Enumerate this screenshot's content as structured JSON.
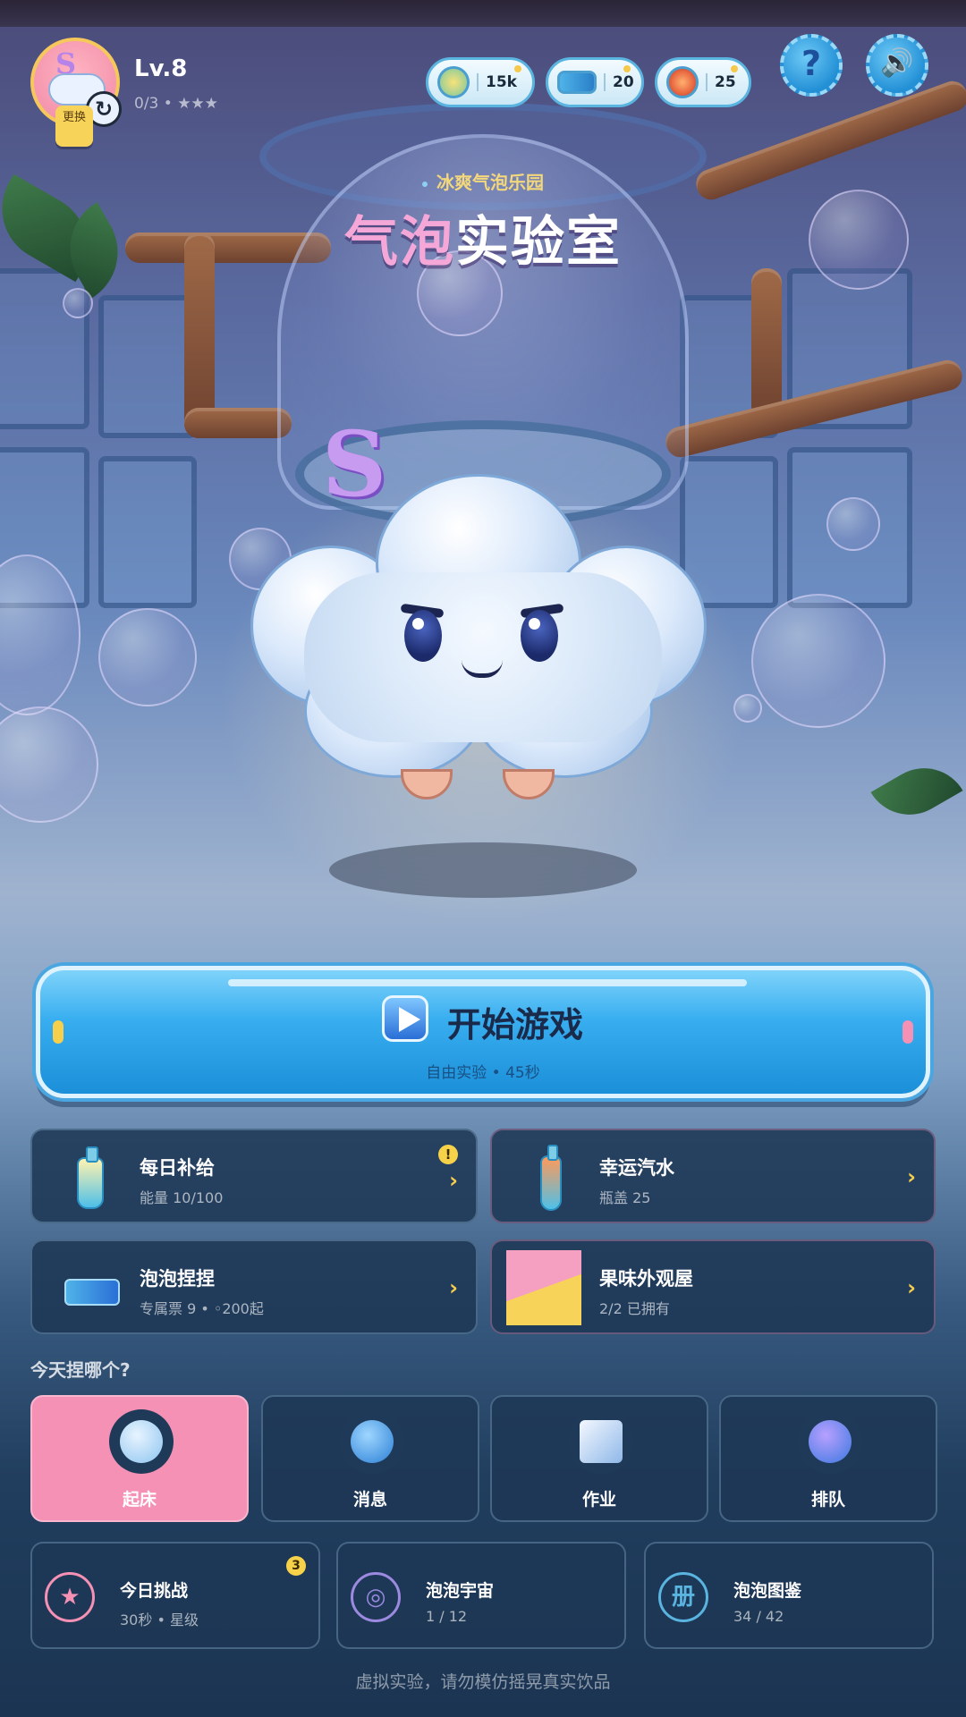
{
  "header": {
    "level": "Lv.8",
    "exp": "0/3 • ★★★",
    "avatar_badge": "更换",
    "avatar_logo": "S",
    "resources": [
      {
        "icon": "coin-icon",
        "value": "15k",
        "color": "#f2c94c"
      },
      {
        "icon": "ticket-icon",
        "value": "20",
        "color": "#4fb3e8"
      },
      {
        "icon": "gem-icon",
        "value": "25",
        "color": "#e8663f"
      }
    ],
    "help_glyph": "?",
    "sound_glyph": "🔊"
  },
  "hero": {
    "subtitle": "冰爽气泡乐园",
    "title_part1": "气泡",
    "title_part2": "实验室",
    "mascot_logo": "S"
  },
  "start": {
    "label": "开始游戏",
    "sub": "自由实验 • 45秒"
  },
  "cards": [
    {
      "title": "每日补给",
      "sub": "能量 10/100",
      "alert": "!",
      "arrow": "›"
    },
    {
      "title": "幸运汽水",
      "sub": "瓶盖 25",
      "arrow": "›"
    },
    {
      "title": "泡泡捏捏",
      "sub": "专属票 9 • ◦200起",
      "arrow": "›"
    },
    {
      "title": "果味外观屋",
      "sub": "2/2 已拥有",
      "arrow": "›"
    }
  ],
  "section_label": "今天捏哪个?",
  "moods": [
    {
      "label": "起床",
      "active": true
    },
    {
      "label": "消息"
    },
    {
      "label": "作业"
    },
    {
      "label": "排队"
    }
  ],
  "bottom_cards": [
    {
      "title": "今日挑战",
      "sub": "30秒 • 星级",
      "glyph": "★",
      "badge": "3",
      "color": "#f591b5"
    },
    {
      "title": "泡泡宇宙",
      "sub": "1 / 12",
      "glyph": "◎",
      "color": "#9b8ae0"
    },
    {
      "title": "泡泡图鉴",
      "sub": "34 / 42",
      "glyph": "册",
      "color": "#5ab4e0"
    }
  ],
  "footer": "虚拟实验，请勿模仿摇晃真实饮品",
  "colors": {
    "accent_pink": "#f591b5",
    "start_blue": "#38aef0",
    "gold": "#f6cf4c"
  }
}
